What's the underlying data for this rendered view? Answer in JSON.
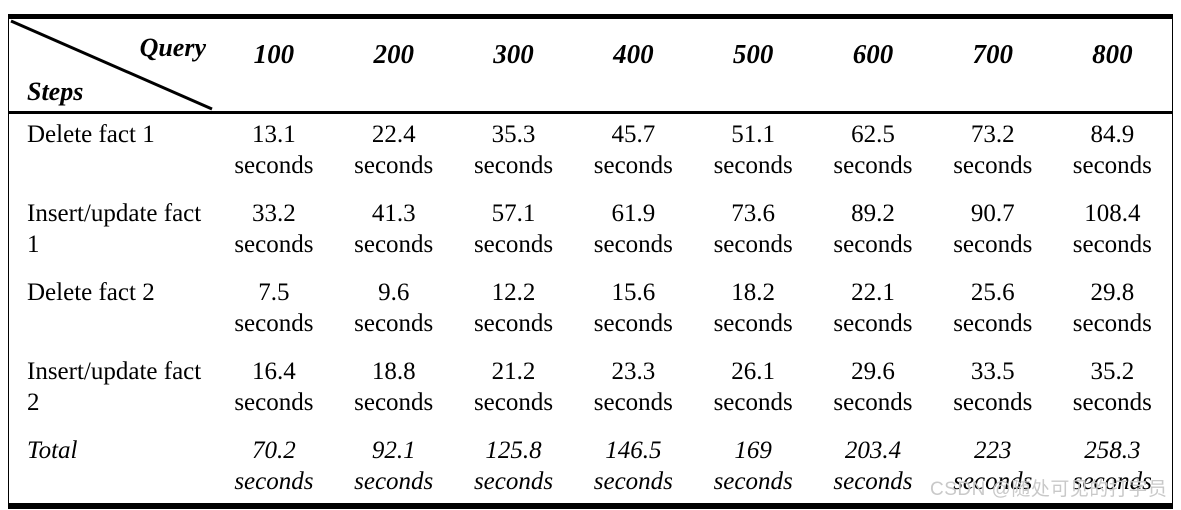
{
  "table": {
    "corner": {
      "column_axis_label": "Query",
      "row_axis_label": "Steps"
    },
    "column_headers": [
      "100",
      "200",
      "300",
      "400",
      "500",
      "600",
      "700",
      "800"
    ],
    "unit_label": "seconds",
    "rows": [
      {
        "step": "Delete fact 1",
        "values": [
          "13.1",
          "22.4",
          "35.3",
          "45.7",
          "51.1",
          "62.5",
          "73.2",
          "84.9"
        ],
        "emphasis": "normal"
      },
      {
        "step": "Insert/update fact 1",
        "values": [
          "33.2",
          "41.3",
          "57.1",
          "61.9",
          "73.6",
          "89.2",
          "90.7",
          "108.4"
        ],
        "emphasis": "normal"
      },
      {
        "step": "Delete fact 2",
        "values": [
          "7.5",
          "9.6",
          "12.2",
          "15.6",
          "18.2",
          "22.1",
          "25.6",
          "29.8"
        ],
        "emphasis": "normal"
      },
      {
        "step": "Insert/update fact 2",
        "values": [
          "16.4",
          "18.8",
          "21.2",
          "23.3",
          "26.1",
          "29.6",
          "33.5",
          "35.2"
        ],
        "emphasis": "normal"
      },
      {
        "step": "Total",
        "values": [
          "70.2",
          "92.1",
          "125.8",
          "146.5",
          "169",
          "203.4",
          "223",
          "258.3"
        ],
        "emphasis": "italic"
      }
    ]
  },
  "watermark": {
    "text": "CSDN @随处可见的打字员"
  },
  "colors": {
    "text": "#000000",
    "rule": "#000000",
    "background": "#ffffff",
    "watermark": "#c9c9c9"
  }
}
